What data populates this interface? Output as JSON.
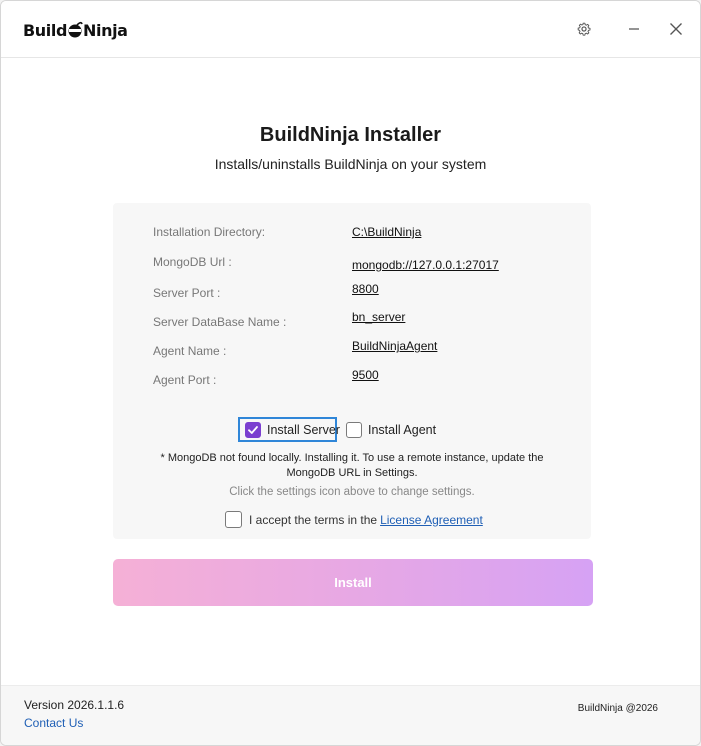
{
  "app": {
    "logo_text_1": "Build",
    "logo_text_2": "Ninja"
  },
  "header": {
    "title": "BuildNinja Installer",
    "subtitle": "Installs/uninstalls BuildNinja on your system"
  },
  "settings": {
    "rows": [
      {
        "label": "Installation Directory:",
        "value": "C:\\BuildNinja"
      },
      {
        "label": "MongoDB Url :",
        "value": "mongodb://127.0.0.1:27017"
      },
      {
        "label": "Server Port :",
        "value": "8800"
      },
      {
        "label": "Server DataBase Name :",
        "value": "bn_server"
      },
      {
        "label": "Agent Name :",
        "value": "BuildNinjaAgent"
      },
      {
        "label": "Agent Port :",
        "value": "9500"
      }
    ]
  },
  "options": {
    "install_server_label": "Install Server",
    "install_server_checked": true,
    "install_agent_label": "Install Agent",
    "install_agent_checked": false
  },
  "messages": {
    "mongo_note_line1": "* MongoDB not found locally. Installing it. To use a remote instance, update the",
    "mongo_note_line2": "MongoDB URL in Settings.",
    "settings_hint": "Click the settings icon above to change settings."
  },
  "terms": {
    "prefix": "I accept the terms in the",
    "link": "License Agreement",
    "checked": false
  },
  "actions": {
    "install_label": "Install"
  },
  "footer": {
    "version": "Version 2026.1.1.6",
    "contact": "Contact Us",
    "copyright": "BuildNinja @2026"
  },
  "icons": {
    "settings": "gear-icon",
    "minimize": "minimize-icon",
    "close": "close-icon"
  },
  "colors": {
    "accent": "#7b3fd0",
    "focus": "#2f86d8",
    "link": "#1f5fb5",
    "install_gradient_start": "#f5b0d6",
    "install_gradient_end": "#d6a2f4"
  }
}
